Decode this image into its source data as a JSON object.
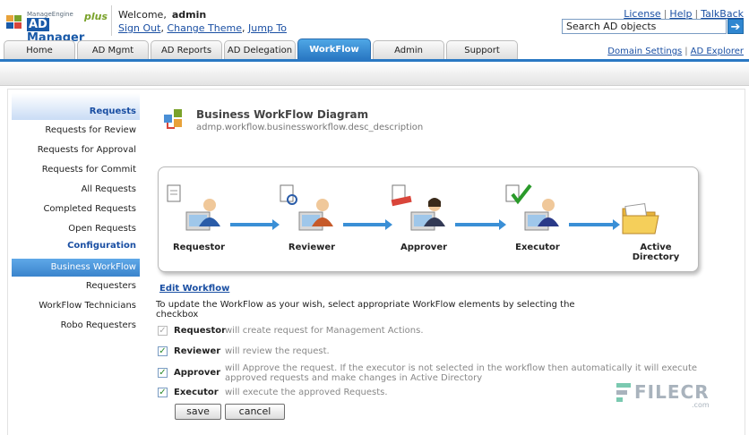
{
  "header": {
    "brand_top": "ManageEngine",
    "brand_main": "AD",
    "brand_rest": "Manager",
    "brand_plus": "plus",
    "welcome_label": "Welcome,",
    "username": "admin",
    "user_links": [
      "Sign Out",
      "Change Theme",
      "Jump To"
    ],
    "top_links": [
      "License",
      "Help",
      "TalkBack"
    ],
    "search_value": "Search AD objects",
    "right_links": [
      "Domain Settings",
      "AD Explorer"
    ]
  },
  "tabs": [
    "Home",
    "AD Mgmt",
    "AD Reports",
    "AD Delegation",
    "WorkFlow",
    "Admin",
    "Support"
  ],
  "active_tab": "WorkFlow",
  "sidebar": {
    "section1": "Requests",
    "requests": [
      "Requests for Review",
      "Requests for Approval",
      "Requests for Commit",
      "All Requests",
      "Completed Requests",
      "Open Requests"
    ],
    "section2": "Configuration",
    "config": [
      "Business WorkFlow",
      "Requesters",
      "WorkFlow Technicians",
      "Robo Requesters"
    ],
    "selected": "Business WorkFlow"
  },
  "main": {
    "title": "Business WorkFlow Diagram",
    "description": "admp.workflow.businessworkflow.desc_description",
    "diagram_nodes": [
      "Requestor",
      "Reviewer",
      "Approver",
      "Executor",
      "Active Directory"
    ],
    "edit_link": "Edit Workflow",
    "instruction": "To update the WorkFlow as your wish, select appropriate WorkFlow elements by selecting the checkbox",
    "options": [
      {
        "name": "Requestor",
        "desc": "will create request for Management Actions.",
        "checked": true,
        "disabled": true
      },
      {
        "name": "Reviewer",
        "desc": "will review the request.",
        "checked": true,
        "disabled": false
      },
      {
        "name": "Approver",
        "desc": "will Approve the request. If the executor is not selected in the workflow then automatically it will execute approved requests and make changes in Active Directory",
        "checked": true,
        "disabled": false
      },
      {
        "name": "Executor",
        "desc": "will execute the approved Requests.",
        "checked": true,
        "disabled": false
      }
    ],
    "save_label": "save",
    "cancel_label": "cancel"
  },
  "watermark": {
    "text": "FILECR",
    "suffix": ".com"
  },
  "colors": {
    "accent": "#2a78c3",
    "link": "#1a4fa3",
    "check": "#2a8a2a"
  }
}
